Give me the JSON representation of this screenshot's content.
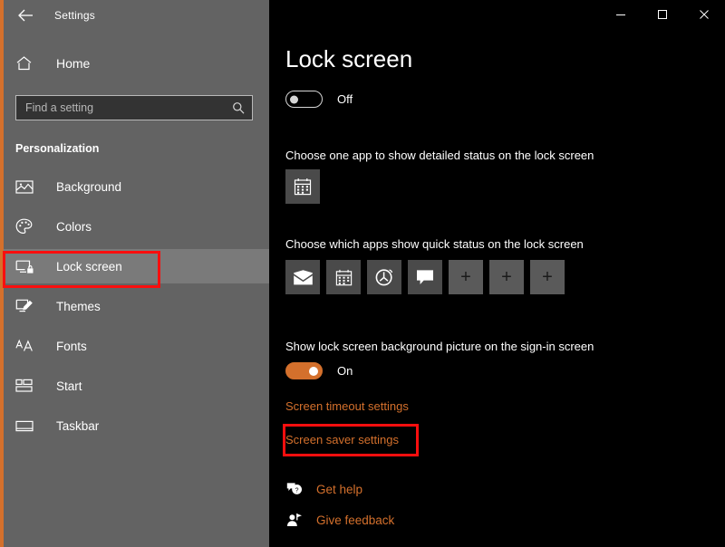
{
  "window": {
    "title": "Settings",
    "back_icon": "back-arrow-icon",
    "controls": {
      "minimize": "–",
      "maximize": "□",
      "close": "✕"
    }
  },
  "sidebar": {
    "home": {
      "label": "Home",
      "icon": "home-icon"
    },
    "search": {
      "placeholder": "Find a setting",
      "value": "",
      "icon": "search-icon"
    },
    "group_header": "Personalization",
    "items": [
      {
        "label": "Background",
        "icon": "image-icon",
        "selected": false
      },
      {
        "label": "Colors",
        "icon": "palette-icon",
        "selected": false
      },
      {
        "label": "Lock screen",
        "icon": "lock-screen-icon",
        "selected": true
      },
      {
        "label": "Themes",
        "icon": "themes-icon",
        "selected": false
      },
      {
        "label": "Fonts",
        "icon": "fonts-icon",
        "selected": false
      },
      {
        "label": "Start",
        "icon": "start-icon",
        "selected": false
      },
      {
        "label": "Taskbar",
        "icon": "taskbar-icon",
        "selected": false
      }
    ]
  },
  "main": {
    "page_title": "Lock screen",
    "lock_toggle": {
      "state": "Off",
      "on": false
    },
    "detailed_status": {
      "label": "Choose one app to show detailed status on the lock screen",
      "tiles": [
        {
          "icon": "calendar-icon",
          "empty": false
        }
      ]
    },
    "quick_status": {
      "label": "Choose which apps show quick status on the lock screen",
      "tiles": [
        {
          "icon": "mail-icon",
          "empty": false
        },
        {
          "icon": "calendar-icon",
          "empty": false
        },
        {
          "icon": "alarm-icon",
          "empty": false
        },
        {
          "icon": "messaging-icon",
          "empty": false
        },
        {
          "icon": "plus-icon",
          "empty": true
        },
        {
          "icon": "plus-icon",
          "empty": true
        },
        {
          "icon": "plus-icon",
          "empty": true
        }
      ]
    },
    "background_picture": {
      "label": "Show lock screen background picture on the sign-in screen",
      "toggle": {
        "state": "On",
        "on": true
      }
    },
    "links": {
      "screen_timeout": "Screen timeout settings",
      "screen_saver": "Screen saver settings"
    },
    "footer": [
      {
        "label": "Get help",
        "icon": "help-bubble-icon"
      },
      {
        "label": "Give feedback",
        "icon": "feedback-person-icon"
      }
    ]
  },
  "annotations": [
    {
      "name": "lock-screen-highlight",
      "color": "#fb0e0e"
    },
    {
      "name": "screen-saver-settings-highlight",
      "color": "#fb0e0e"
    }
  ],
  "colors": {
    "accent": "#d4702c",
    "sidebar_bg": "#636363",
    "main_bg": "#000000",
    "selected_item_bg": "#7a7a7a",
    "annotation": "#fb0e0e"
  }
}
